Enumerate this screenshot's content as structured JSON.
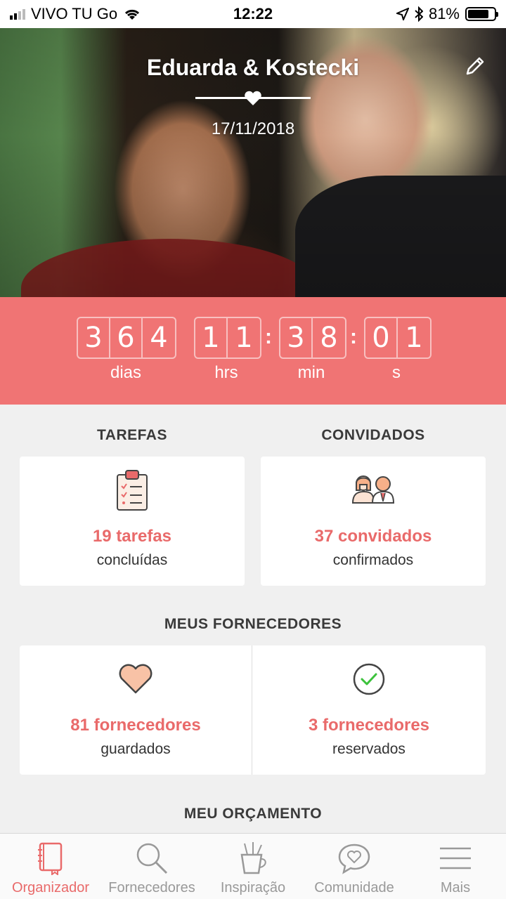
{
  "status_bar": {
    "carrier": "VIVO TU Go",
    "time": "12:22",
    "battery": "81%",
    "battery_level": 0.81
  },
  "hero": {
    "couple_names": "Eduarda & Kostecki",
    "wedding_date": "17/11/2018",
    "edit_icon": "pencil-icon",
    "heart_icon": "heart-icon"
  },
  "countdown": {
    "days": [
      "3",
      "6",
      "4"
    ],
    "hours": [
      "1",
      "1"
    ],
    "minutes": [
      "3",
      "8"
    ],
    "seconds": [
      "0",
      "1"
    ],
    "separator": ":",
    "labels": {
      "days": "dias",
      "hours": "hrs",
      "minutes": "min",
      "seconds": "s"
    }
  },
  "tasks": {
    "title": "TAREFAS",
    "value": "19 tarefas",
    "sub": "concluídas",
    "icon": "clipboard-checklist-icon"
  },
  "guests": {
    "title": "CONVIDADOS",
    "value": "37 convidados",
    "sub": "confirmados",
    "icon": "couple-guests-icon"
  },
  "vendors": {
    "title": "MEUS FORNECEDORES",
    "saved": {
      "value": "81 fornecedores",
      "sub": "guardados",
      "icon": "heart-icon"
    },
    "booked": {
      "value": "3 fornecedores",
      "sub": "reservados",
      "icon": "check-circle-icon"
    }
  },
  "budget": {
    "title": "MEU ORÇAMENTO"
  },
  "nav": {
    "items": [
      {
        "label": "Organizador",
        "icon": "notebook-icon",
        "active": true
      },
      {
        "label": "Fornecedores",
        "icon": "search-icon",
        "active": false
      },
      {
        "label": "Inspiração",
        "icon": "pencil-cup-icon",
        "active": false
      },
      {
        "label": "Comunidade",
        "icon": "chat-heart-icon",
        "active": false
      },
      {
        "label": "Mais",
        "icon": "menu-icon",
        "active": false
      }
    ]
  },
  "colors": {
    "accent": "#f07474",
    "accent_text": "#e96a6a",
    "background": "#f0f0f0"
  }
}
